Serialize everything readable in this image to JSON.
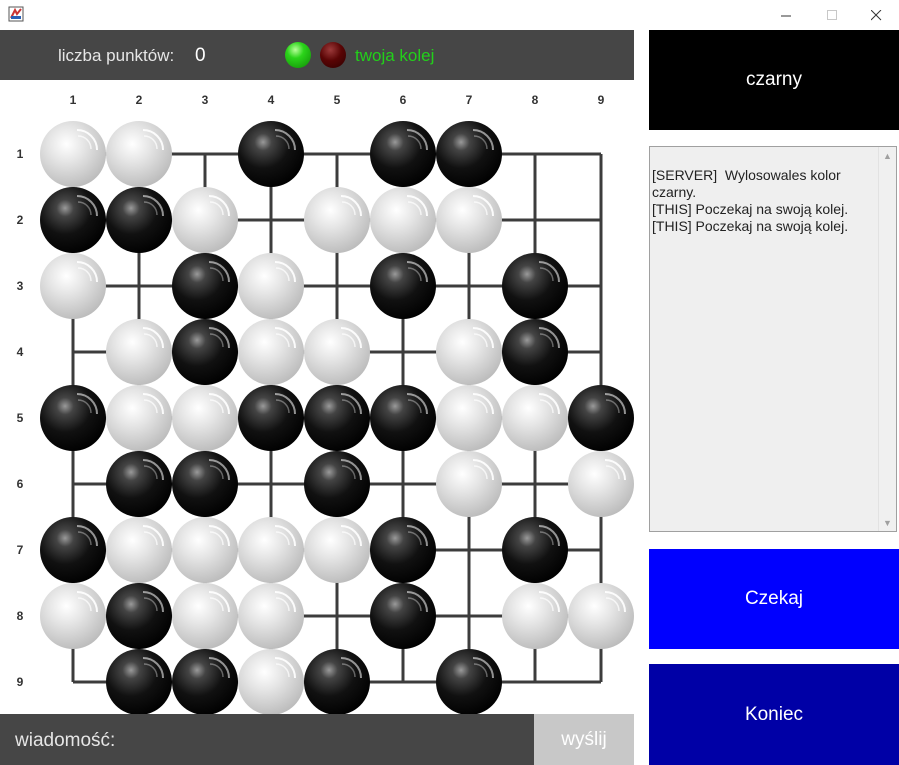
{
  "window": {
    "icons": {
      "app": "app-icon",
      "minimize": "minimize-icon",
      "maximize": "maximize-icon",
      "close": "close-icon"
    }
  },
  "status": {
    "points_label": "liczba punktów:",
    "points_value": "0",
    "turn_text": "twoja kolej",
    "lights": {
      "green": "#22d01a",
      "red": "#5a0505"
    }
  },
  "board": {
    "size": 9,
    "column_labels": [
      "1",
      "2",
      "3",
      "4",
      "5",
      "6",
      "7",
      "8",
      "9"
    ],
    "row_labels": [
      "1",
      "2",
      "3",
      "4",
      "5",
      "6",
      "7",
      "8",
      "9"
    ],
    "stones": [
      "WW.B.BB..",
      "BBW.WWW..",
      "W.BW.B.B.",
      ".WBWW.WB.",
      "BWWBBBWWB",
      ".BB.B.W.W",
      "BWWWWB.B.",
      "WBWW.B.WW",
      ".BBWB.B.."
    ],
    "colors": {
      "black_stone": "#000000",
      "white_stone": "#d8d8d8",
      "grid": "#3c3c3c"
    }
  },
  "message": {
    "label": "wiadomość:",
    "input_value": "",
    "send_label": "wyślij"
  },
  "side": {
    "color_label": "czarny",
    "log": [
      "[SERVER]  Wylosowales kolor czarny.",
      "[THIS] Poczekaj na swoją kolej.",
      "[THIS] Poczekaj na swoją kolej."
    ],
    "wait_label": "Czekaj",
    "end_label": "Koniec"
  },
  "colors": {
    "dark_bar": "#464646",
    "send_button": "#c8c8c8",
    "wait_button": "#0000ff",
    "end_button": "#0000a6",
    "color_panel": "#000000"
  }
}
